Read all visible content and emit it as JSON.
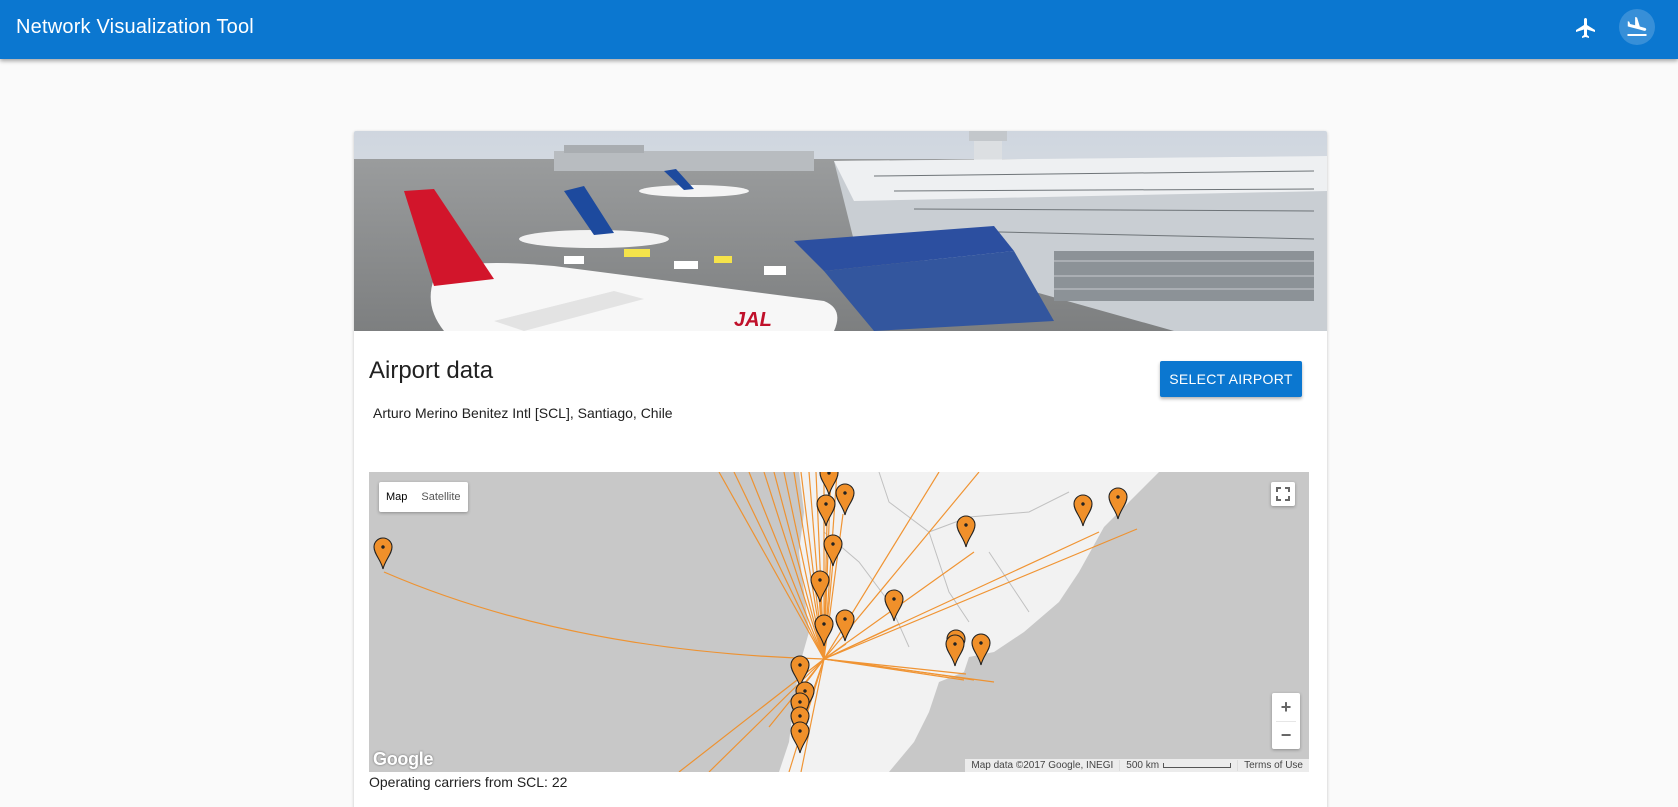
{
  "header": {
    "title": "Network Visualization Tool",
    "flight_icon": "airplane-icon",
    "landing_icon": "flight-land-icon",
    "background": "#0b77d0"
  },
  "card": {
    "hero_image": "airport-terminal-photo",
    "title": "Airport data",
    "airport": "Arturo Merino Benitez Intl [SCL], Santiago, Chile",
    "select_button": "SELECT AIRPORT",
    "carriers_text": "Operating carriers from SCL: 22"
  },
  "map": {
    "type_controls": [
      "Map",
      "Satellite"
    ],
    "active_type": "Map",
    "fullscreen_icon": "fullscreen-icon",
    "zoom_in": "+",
    "zoom_out": "−",
    "logo": "Google",
    "map_data": "Map data ©2017 Google, INEGI",
    "scale": "500 km",
    "terms": "Terms of Use",
    "route_color": "#f0902a",
    "marker_color": "#f0902a"
  }
}
